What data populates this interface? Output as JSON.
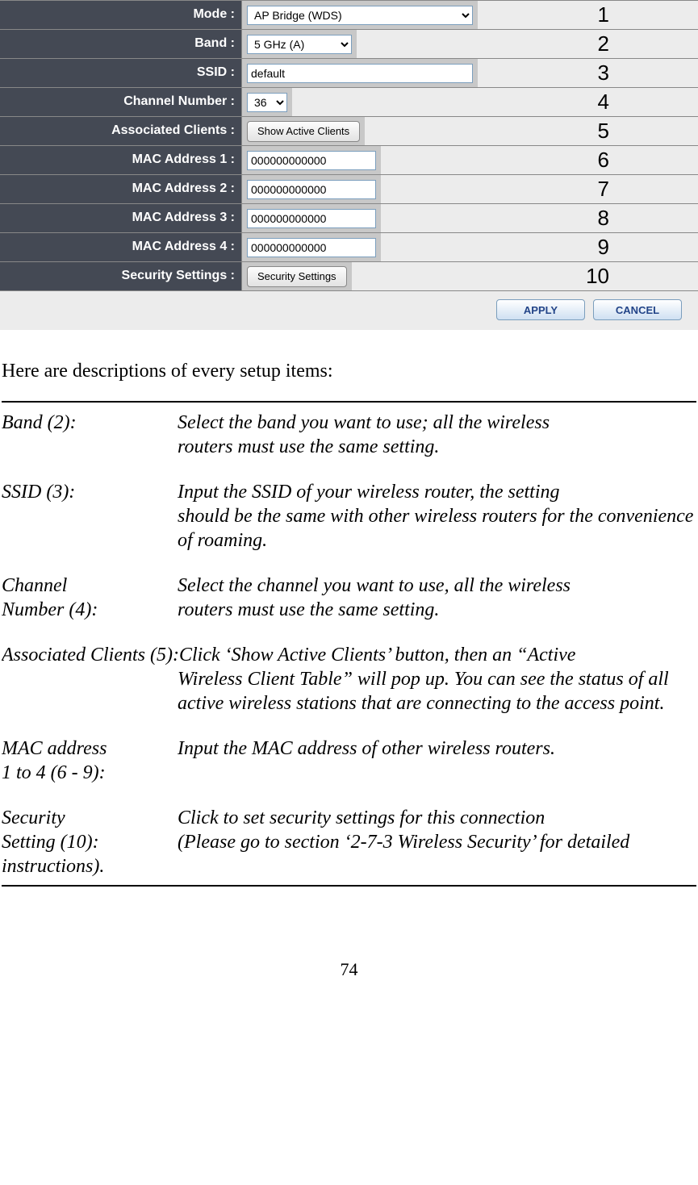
{
  "form": {
    "rows": [
      {
        "label": "Mode :",
        "ctrl": "select",
        "value": "AP Bridge (WDS)",
        "cls": "w-mode",
        "name": "mode-select",
        "annot": "1"
      },
      {
        "label": "Band :",
        "ctrl": "select",
        "value": "5 GHz (A)",
        "cls": "w-band",
        "name": "band-select",
        "annot": "2"
      },
      {
        "label": "SSID :",
        "ctrl": "text",
        "value": "default",
        "cls": "w-ssid",
        "name": "ssid-input",
        "annot": "3"
      },
      {
        "label": "Channel Number :",
        "ctrl": "select",
        "value": "36",
        "cls": "w-chan",
        "name": "channel-select",
        "annot": "4"
      },
      {
        "label": "Associated Clients :",
        "ctrl": "button",
        "value": "Show Active Clients",
        "name": "show-clients-button",
        "annot": "5"
      },
      {
        "label": "MAC Address 1 :",
        "ctrl": "text",
        "value": "000000000000",
        "cls": "w-mac",
        "name": "mac1-input",
        "annot": "6"
      },
      {
        "label": "MAC Address 2 :",
        "ctrl": "text",
        "value": "000000000000",
        "cls": "w-mac",
        "name": "mac2-input",
        "annot": "7"
      },
      {
        "label": "MAC Address 3 :",
        "ctrl": "text",
        "value": "000000000000",
        "cls": "w-mac",
        "name": "mac3-input",
        "annot": "8"
      },
      {
        "label": "MAC Address 4 :",
        "ctrl": "text",
        "value": "000000000000",
        "cls": "w-mac",
        "name": "mac4-input",
        "annot": "9"
      },
      {
        "label": "Security Settings :",
        "ctrl": "button",
        "value": "Security Settings",
        "name": "security-settings-button",
        "annot": "10"
      }
    ],
    "apply": "APPLY",
    "cancel": "CANCEL"
  },
  "intro": "Here are descriptions of every setup items:",
  "defs": [
    {
      "term": "Band (2):",
      "first": "Select the band you want to use; all the wireless",
      "rest": "routers must use the same setting."
    },
    {
      "term": "SSID (3):",
      "first": "Input the SSID of your wireless router, the setting",
      "rest": "should be the same with other wireless routers for the convenience of roaming."
    },
    {
      "term": "Channel Number (4):",
      "first": "Select the channel you want to use, all the wireless",
      "rest": "routers must use the same setting.",
      "twoLineTerm": true,
      "term1": "Channel",
      "term2": "Number (4):"
    },
    {
      "wide": true,
      "termWide": "Associated Clients (5):",
      "firstWide": "Click ‘Show Active Clients’ button, then an “Active",
      "rest": "Wireless Client Table” will pop up. You can see the status of all active wireless stations that are connecting to the access point."
    },
    {
      "term": "MAC address 1 to 4 (6 - 9):",
      "first": "Input the MAC address of other wireless routers.",
      "rest": "",
      "twoLineTerm": true,
      "term1": "MAC address",
      "term2": "1 to 4 (6 - 9):"
    },
    {
      "term": "Security Setting (10):",
      "first": "Click to set security settings for this connection",
      "rest": "(Please go to section ‘2-7-3 Wireless Security’ for detailed instructions).",
      "twoLineTerm": true,
      "term1": "Security",
      "term2": "Setting (10):",
      "lastEntry": true
    }
  ],
  "page": "74"
}
